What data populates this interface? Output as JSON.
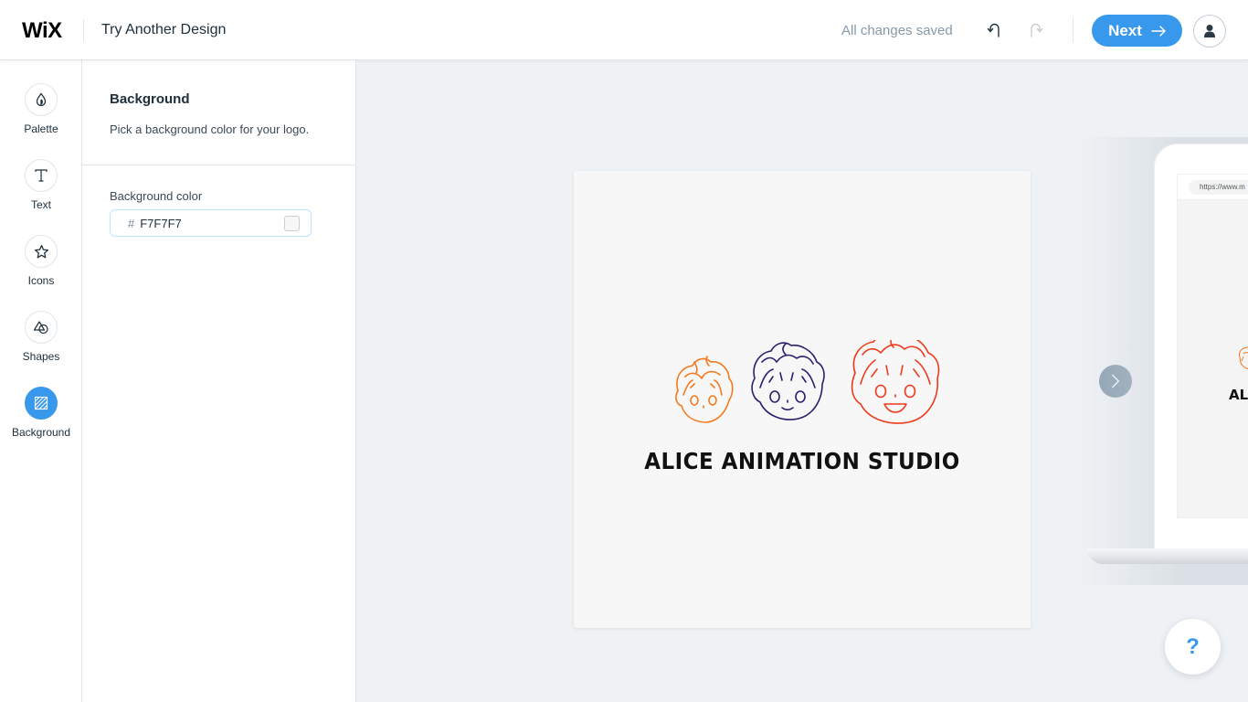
{
  "header": {
    "brand": "WiX",
    "title": "Try Another Design",
    "saved_status": "All changes saved",
    "next_label": "Next"
  },
  "icons": {
    "undo": "undo-icon",
    "redo": "redo-icon",
    "next_arrow": "arrow-right-icon",
    "avatar": "user-icon",
    "carousel_next": "chevron-right-icon",
    "help": "question-mark-icon"
  },
  "rail": {
    "items": [
      {
        "label": "Palette",
        "icon": "droplet-icon",
        "active": false
      },
      {
        "label": "Text",
        "icon": "text-icon",
        "active": false
      },
      {
        "label": "Icons",
        "icon": "star-icon",
        "active": false
      },
      {
        "label": "Shapes",
        "icon": "shapes-icon",
        "active": false
      },
      {
        "label": "Background",
        "icon": "background-hatch-icon",
        "active": true
      }
    ]
  },
  "panel": {
    "title": "Background",
    "description": "Pick a background color for your logo.",
    "field_label": "Background color",
    "hash_symbol": "#",
    "color_value": "F7F7F7"
  },
  "canvas": {
    "brand_name": "ALICE ANIMATION STUDIO",
    "background_color": "#F7F7F7",
    "face_colors": [
      "#f47a20",
      "#2c1e70",
      "#ee3a1b"
    ]
  },
  "mockup": {
    "url": "https://www.m",
    "mini_name": "ALI"
  },
  "help": {
    "label": "?"
  },
  "colors": {
    "accent": "#3899ec",
    "text": "#20303c",
    "muted": "#8899a8"
  }
}
